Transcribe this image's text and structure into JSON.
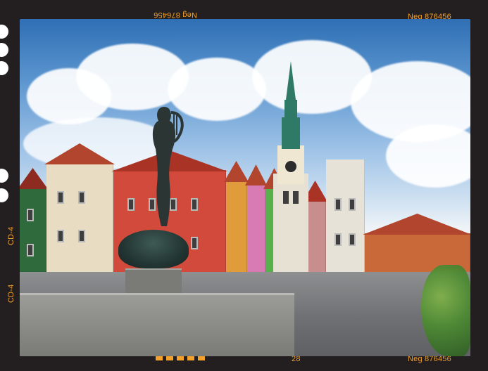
{
  "film": {
    "neg_top_left": "Neg 876456",
    "neg_top_right": "Neg 876456",
    "neg_bottom_right": "Neg 876456",
    "frame_number": "28",
    "cd_left_upper": "CD-4",
    "cd_left_lower": "CD-4"
  },
  "colors": {
    "film_border": "#231f20",
    "film_text": "#f3a12a",
    "sprocket_holes": "#ffffff"
  }
}
